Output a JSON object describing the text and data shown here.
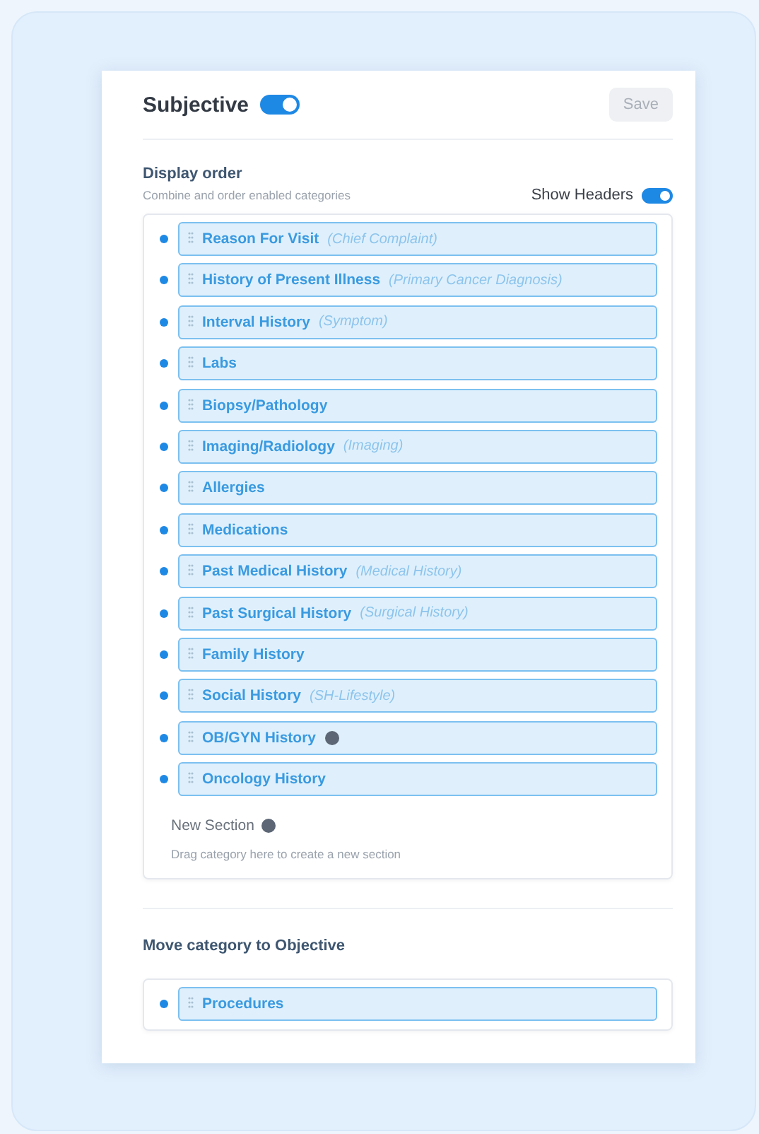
{
  "header": {
    "title": "Subjective",
    "enabled": true,
    "save_label": "Save",
    "save_disabled": true
  },
  "display_order": {
    "title": "Display order",
    "subtitle": "Combine and order enabled categories",
    "show_headers_label": "Show Headers",
    "show_headers": true,
    "categories": [
      {
        "label": "Reason For Visit",
        "alias": "(Chief Complaint)",
        "visible": true,
        "help": false
      },
      {
        "label": "History of Present Illness",
        "alias": "(Primary Cancer Diagnosis)",
        "visible": true,
        "help": false
      },
      {
        "label": "Interval History",
        "alias": "(Symptom)",
        "visible": true,
        "help": false
      },
      {
        "label": "Labs",
        "visible": true,
        "help": false
      },
      {
        "label": "Biopsy/Pathology",
        "visible": true,
        "help": false
      },
      {
        "label": "Imaging/Radiology",
        "alias": "(Imaging)",
        "visible": true,
        "help": false
      },
      {
        "label": "Allergies",
        "visible": true,
        "help": false
      },
      {
        "label": "Medications",
        "visible": true,
        "help": false
      },
      {
        "label": "Past Medical History",
        "alias": "(Medical History)",
        "visible": true,
        "help": false
      },
      {
        "label": "Past Surgical History",
        "alias": "(Surgical History)",
        "visible": true,
        "help": false
      },
      {
        "label": "Family History",
        "visible": true,
        "help": false
      },
      {
        "label": "Social History",
        "alias": "(SH-Lifestyle)",
        "visible": true,
        "help": false
      },
      {
        "label": "OB/GYN History",
        "visible": true,
        "help": true
      },
      {
        "label": "Oncology History",
        "visible": true,
        "help": false
      }
    ],
    "new_section": {
      "title": "New Section",
      "hint": "Drag category here to create a new section"
    }
  },
  "move": {
    "title": "Move category to Objective",
    "categories": [
      {
        "label": "Procedures",
        "visible": true,
        "help": false
      }
    ]
  }
}
